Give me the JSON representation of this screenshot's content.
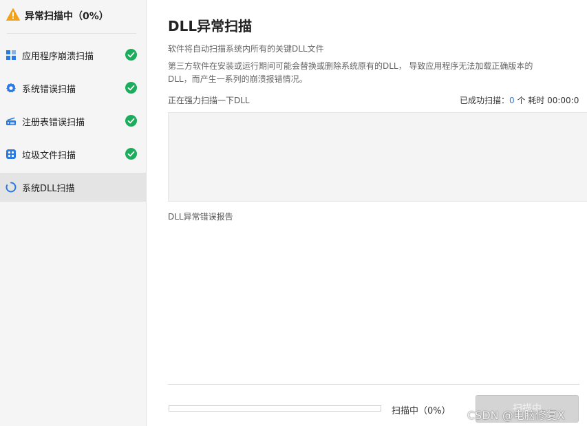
{
  "status": {
    "text": "异常扫描中（0%）",
    "icon": "warning-icon",
    "icon_color": "#f2a11b"
  },
  "sidebar": {
    "items": [
      {
        "label": "应用程序崩溃扫描",
        "icon": "app-grid-icon",
        "done": true
      },
      {
        "label": "系统错误扫描",
        "icon": "gear-icon",
        "done": true
      },
      {
        "label": "注册表错误扫描",
        "icon": "registry-icon",
        "done": true
      },
      {
        "label": "垃圾文件扫描",
        "icon": "junk-files-icon",
        "done": true
      },
      {
        "label": "系统DLL扫描",
        "icon": "loading-spinner-icon",
        "done": false,
        "active": true
      }
    ],
    "check_color": "#1aad5b",
    "icon_color": "#2a7ae2"
  },
  "main": {
    "title": "DLL异常扫描",
    "desc_line1": "软件将自动扫描系统内所有的关键DLL文件",
    "desc_line2": "第三方软件在安装或运行期间可能会替换或删除系统原有的DLL， 导致应用程序无法加载正确版本的",
    "desc_line3": "DLL，而产生一系列的崩溃报错情况。",
    "scan_label": "正在强力扫描一下DLL",
    "stats_prefix": "已成功扫描：",
    "stats_count": "0",
    "stats_suffix": " 个 耗时 00:00:0",
    "report_label": "DLL异常错误报告",
    "progress_percent": 0,
    "progress_text": "扫描中（0%）",
    "button_label": "扫描中",
    "watermark": "CSDN @电脑修复X"
  }
}
